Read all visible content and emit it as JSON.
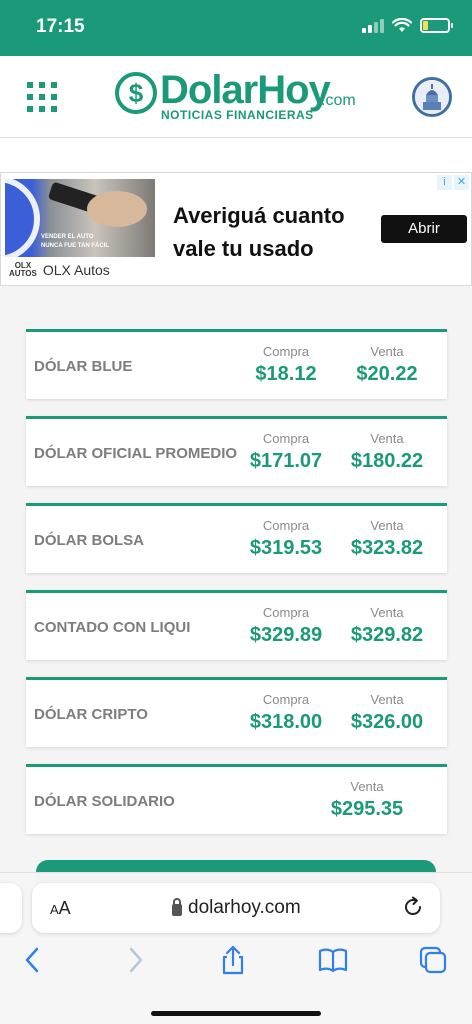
{
  "status": {
    "time": "17:15"
  },
  "header": {
    "logo_symbol": "$",
    "logo_name": "DolarHoy",
    "logo_domain": ".com",
    "logo_subtitle": "NOTICIAS FINANCIERAS"
  },
  "ad": {
    "image_text_1": "VENDER EL AUTO",
    "image_text_2": "NUNCA FUE TAN FÁCIL",
    "headline": "Averiguá cuanto vale tu usado",
    "cta": "Abrir",
    "brand_logo_top": "OLX",
    "brand_logo_bottom": "AUTOS",
    "brand": "OLX Autos",
    "info_icon": "i",
    "close_icon": "✕"
  },
  "rates": [
    {
      "name": "DÓLAR BLUE",
      "buy_label": "Compra",
      "buy": "$18.12",
      "sell_label": "Venta",
      "sell": "$20.22"
    },
    {
      "name": "DÓLAR OFICIAL PROMEDIO",
      "buy_label": "Compra",
      "buy": "$171.07",
      "sell_label": "Venta",
      "sell": "$180.22"
    },
    {
      "name": "DÓLAR BOLSA",
      "buy_label": "Compra",
      "buy": "$319.53",
      "sell_label": "Venta",
      "sell": "$323.82"
    },
    {
      "name": "CONTADO CON LIQUI",
      "buy_label": "Compra",
      "buy": "$329.89",
      "sell_label": "Venta",
      "sell": "$329.82"
    },
    {
      "name": "DÓLAR CRIPTO",
      "buy_label": "Compra",
      "buy": "$318.00",
      "sell_label": "Venta",
      "sell": "$326.00"
    },
    {
      "name": "DÓLAR SOLIDARIO",
      "sell_label": "Venta",
      "sell": "$295.35"
    }
  ],
  "browser": {
    "aa_small": "A",
    "aa_large": "A",
    "url": "dolarhoy.com"
  },
  "colors": {
    "brand": "#1a9a78",
    "ios_blue": "#2f80ed"
  }
}
